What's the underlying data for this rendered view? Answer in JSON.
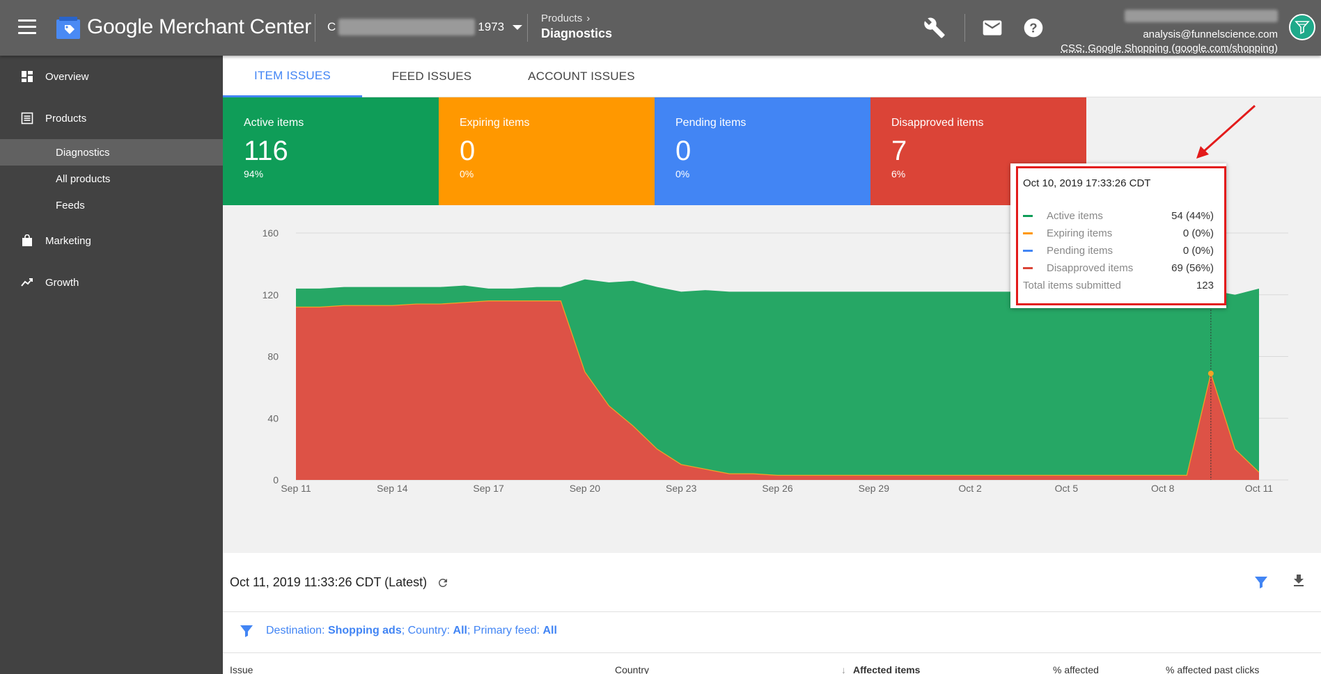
{
  "app": {
    "title": "Google Merchant Center",
    "account_suffix": "1973"
  },
  "breadcrumb": {
    "parent": "Products",
    "current": "Diagnostics"
  },
  "user": {
    "email": "analysis@funnelscience.com",
    "css": "CSS: Google Shopping (google.com/shopping)"
  },
  "sidebar": {
    "items": [
      {
        "label": "Overview"
      },
      {
        "label": "Products"
      },
      {
        "label": "Diagnostics"
      },
      {
        "label": "All products"
      },
      {
        "label": "Feeds"
      },
      {
        "label": "Marketing"
      },
      {
        "label": "Growth"
      }
    ]
  },
  "tabs": [
    {
      "label": "ITEM ISSUES"
    },
    {
      "label": "FEED ISSUES"
    },
    {
      "label": "ACCOUNT ISSUES"
    }
  ],
  "cards": [
    {
      "title": "Active items",
      "count": "116",
      "pct": "94%",
      "color": "#0f9d58"
    },
    {
      "title": "Expiring items",
      "count": "0",
      "pct": "0%",
      "color": "#ff9800"
    },
    {
      "title": "Pending items",
      "count": "0",
      "pct": "0%",
      "color": "#4285f4"
    },
    {
      "title": "Disapproved items",
      "count": "7",
      "pct": "6%",
      "color": "#db4437"
    }
  ],
  "tooltip": {
    "date": "Oct 10, 2019 17:33:26 CDT",
    "rows": [
      {
        "name": "Active items",
        "value": "54 (44%)",
        "color": "#0f9d58"
      },
      {
        "name": "Expiring items",
        "value": "0 (0%)",
        "color": "#ff9800"
      },
      {
        "name": "Pending items",
        "value": "0 (0%)",
        "color": "#4285f4"
      },
      {
        "name": "Disapproved items",
        "value": "69 (56%)",
        "color": "#db4437"
      }
    ],
    "total_label": "Total items submitted",
    "total_value": "123"
  },
  "chart_data": {
    "type": "area",
    "xlabels": [
      "Sep 11",
      "Sep 14",
      "Sep 17",
      "Sep 20",
      "Sep 23",
      "Sep 26",
      "Sep 29",
      "Oct 2",
      "Oct 5",
      "Oct 8",
      "Oct 11"
    ],
    "yticks": [
      0,
      40,
      80,
      120,
      160
    ],
    "ylim": [
      0,
      160
    ],
    "colors": {
      "active": "#26a765",
      "disapproved": "#dd5246",
      "expiring": "#f4a325",
      "grid": "#d9d9d9"
    },
    "series": [
      {
        "name": "Active items",
        "values": [
          12,
          12,
          12,
          12,
          12,
          11,
          11,
          11,
          8,
          8,
          9,
          9,
          60,
          80,
          94,
          105,
          112,
          116,
          118,
          118,
          119,
          119,
          119,
          119,
          119,
          119,
          119,
          119,
          119,
          119,
          119,
          119,
          120,
          120,
          120,
          120,
          120,
          120,
          54,
          100,
          119
        ]
      },
      {
        "name": "Disapproved items",
        "values": [
          112,
          112,
          113,
          113,
          113,
          114,
          114,
          115,
          116,
          116,
          116,
          116,
          70,
          48,
          35,
          20,
          10,
          7,
          4,
          4,
          3,
          3,
          3,
          3,
          3,
          3,
          3,
          3,
          3,
          3,
          3,
          3,
          3,
          3,
          3,
          3,
          3,
          3,
          69,
          20,
          5
        ]
      }
    ]
  },
  "snapshot": {
    "label": "Oct 11, 2019 11:33:26 CDT (Latest)"
  },
  "filters": {
    "destination_label": "Destination:",
    "destination_value": "Shopping ads",
    "country_label": "; Country:",
    "country_value": "All",
    "feed_label": "; Primary feed:",
    "feed_value": "All"
  },
  "table": {
    "headers": [
      "Issue",
      "Country",
      "Affected items",
      "% affected",
      "% affected past clicks"
    ]
  }
}
